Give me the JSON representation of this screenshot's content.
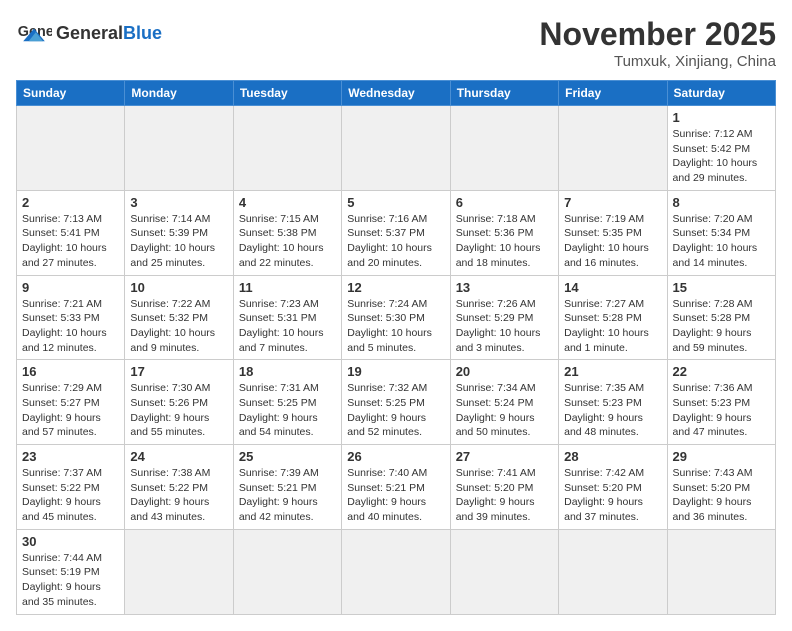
{
  "header": {
    "logo_general": "General",
    "logo_blue": "Blue",
    "month_title": "November 2025",
    "location": "Tumxuk, Xinjiang, China"
  },
  "weekdays": [
    "Sunday",
    "Monday",
    "Tuesday",
    "Wednesday",
    "Thursday",
    "Friday",
    "Saturday"
  ],
  "weeks": [
    [
      {
        "day": "",
        "info": "",
        "empty": true
      },
      {
        "day": "",
        "info": "",
        "empty": true
      },
      {
        "day": "",
        "info": "",
        "empty": true
      },
      {
        "day": "",
        "info": "",
        "empty": true
      },
      {
        "day": "",
        "info": "",
        "empty": true
      },
      {
        "day": "",
        "info": "",
        "empty": true
      },
      {
        "day": "1",
        "info": "Sunrise: 7:12 AM\nSunset: 5:42 PM\nDaylight: 10 hours and 29 minutes.",
        "empty": false
      }
    ],
    [
      {
        "day": "2",
        "info": "Sunrise: 7:13 AM\nSunset: 5:41 PM\nDaylight: 10 hours and 27 minutes.",
        "empty": false
      },
      {
        "day": "3",
        "info": "Sunrise: 7:14 AM\nSunset: 5:39 PM\nDaylight: 10 hours and 25 minutes.",
        "empty": false
      },
      {
        "day": "4",
        "info": "Sunrise: 7:15 AM\nSunset: 5:38 PM\nDaylight: 10 hours and 22 minutes.",
        "empty": false
      },
      {
        "day": "5",
        "info": "Sunrise: 7:16 AM\nSunset: 5:37 PM\nDaylight: 10 hours and 20 minutes.",
        "empty": false
      },
      {
        "day": "6",
        "info": "Sunrise: 7:18 AM\nSunset: 5:36 PM\nDaylight: 10 hours and 18 minutes.",
        "empty": false
      },
      {
        "day": "7",
        "info": "Sunrise: 7:19 AM\nSunset: 5:35 PM\nDaylight: 10 hours and 16 minutes.",
        "empty": false
      },
      {
        "day": "8",
        "info": "Sunrise: 7:20 AM\nSunset: 5:34 PM\nDaylight: 10 hours and 14 minutes.",
        "empty": false
      }
    ],
    [
      {
        "day": "9",
        "info": "Sunrise: 7:21 AM\nSunset: 5:33 PM\nDaylight: 10 hours and 12 minutes.",
        "empty": false
      },
      {
        "day": "10",
        "info": "Sunrise: 7:22 AM\nSunset: 5:32 PM\nDaylight: 10 hours and 9 minutes.",
        "empty": false
      },
      {
        "day": "11",
        "info": "Sunrise: 7:23 AM\nSunset: 5:31 PM\nDaylight: 10 hours and 7 minutes.",
        "empty": false
      },
      {
        "day": "12",
        "info": "Sunrise: 7:24 AM\nSunset: 5:30 PM\nDaylight: 10 hours and 5 minutes.",
        "empty": false
      },
      {
        "day": "13",
        "info": "Sunrise: 7:26 AM\nSunset: 5:29 PM\nDaylight: 10 hours and 3 minutes.",
        "empty": false
      },
      {
        "day": "14",
        "info": "Sunrise: 7:27 AM\nSunset: 5:28 PM\nDaylight: 10 hours and 1 minute.",
        "empty": false
      },
      {
        "day": "15",
        "info": "Sunrise: 7:28 AM\nSunset: 5:28 PM\nDaylight: 9 hours and 59 minutes.",
        "empty": false
      }
    ],
    [
      {
        "day": "16",
        "info": "Sunrise: 7:29 AM\nSunset: 5:27 PM\nDaylight: 9 hours and 57 minutes.",
        "empty": false
      },
      {
        "day": "17",
        "info": "Sunrise: 7:30 AM\nSunset: 5:26 PM\nDaylight: 9 hours and 55 minutes.",
        "empty": false
      },
      {
        "day": "18",
        "info": "Sunrise: 7:31 AM\nSunset: 5:25 PM\nDaylight: 9 hours and 54 minutes.",
        "empty": false
      },
      {
        "day": "19",
        "info": "Sunrise: 7:32 AM\nSunset: 5:25 PM\nDaylight: 9 hours and 52 minutes.",
        "empty": false
      },
      {
        "day": "20",
        "info": "Sunrise: 7:34 AM\nSunset: 5:24 PM\nDaylight: 9 hours and 50 minutes.",
        "empty": false
      },
      {
        "day": "21",
        "info": "Sunrise: 7:35 AM\nSunset: 5:23 PM\nDaylight: 9 hours and 48 minutes.",
        "empty": false
      },
      {
        "day": "22",
        "info": "Sunrise: 7:36 AM\nSunset: 5:23 PM\nDaylight: 9 hours and 47 minutes.",
        "empty": false
      }
    ],
    [
      {
        "day": "23",
        "info": "Sunrise: 7:37 AM\nSunset: 5:22 PM\nDaylight: 9 hours and 45 minutes.",
        "empty": false
      },
      {
        "day": "24",
        "info": "Sunrise: 7:38 AM\nSunset: 5:22 PM\nDaylight: 9 hours and 43 minutes.",
        "empty": false
      },
      {
        "day": "25",
        "info": "Sunrise: 7:39 AM\nSunset: 5:21 PM\nDaylight: 9 hours and 42 minutes.",
        "empty": false
      },
      {
        "day": "26",
        "info": "Sunrise: 7:40 AM\nSunset: 5:21 PM\nDaylight: 9 hours and 40 minutes.",
        "empty": false
      },
      {
        "day": "27",
        "info": "Sunrise: 7:41 AM\nSunset: 5:20 PM\nDaylight: 9 hours and 39 minutes.",
        "empty": false
      },
      {
        "day": "28",
        "info": "Sunrise: 7:42 AM\nSunset: 5:20 PM\nDaylight: 9 hours and 37 minutes.",
        "empty": false
      },
      {
        "day": "29",
        "info": "Sunrise: 7:43 AM\nSunset: 5:20 PM\nDaylight: 9 hours and 36 minutes.",
        "empty": false
      }
    ],
    [
      {
        "day": "30",
        "info": "Sunrise: 7:44 AM\nSunset: 5:19 PM\nDaylight: 9 hours and 35 minutes.",
        "empty": false
      },
      {
        "day": "",
        "info": "",
        "empty": true
      },
      {
        "day": "",
        "info": "",
        "empty": true
      },
      {
        "day": "",
        "info": "",
        "empty": true
      },
      {
        "day": "",
        "info": "",
        "empty": true
      },
      {
        "day": "",
        "info": "",
        "empty": true
      },
      {
        "day": "",
        "info": "",
        "empty": true
      }
    ]
  ]
}
